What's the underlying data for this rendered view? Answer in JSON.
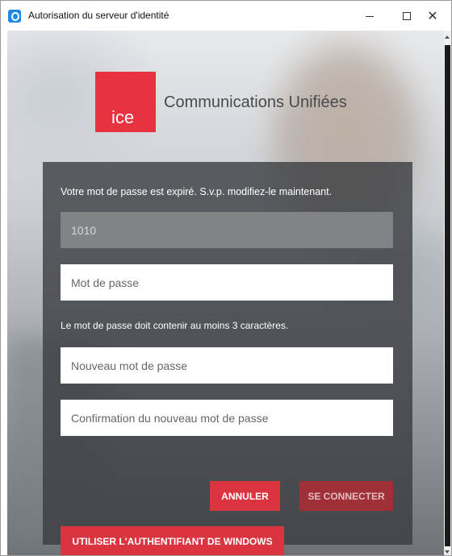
{
  "window": {
    "title": "Autorisation du serveur d'identité",
    "close_label": "✕"
  },
  "brand": {
    "logo_text": "ice",
    "name": "Communications Unifiées"
  },
  "form": {
    "expired_message": "Votre mot de passe est expiré. S.v.p. modifiez-le maintenant.",
    "username_value": "1010",
    "password_placeholder": "Mot de passe",
    "rule_message": "Le mot de passe doit contenir au moins 3 caractères.",
    "new_password_placeholder": "Nouveau mot de passe",
    "confirm_password_placeholder": "Confirmation du nouveau mot de passe"
  },
  "buttons": {
    "cancel": "ANNULER",
    "connect": "SE CONNECTER",
    "windows_auth": "UTILISER L'AUTHENTIFIANT DE WINDOWS"
  },
  "colors": {
    "accent": "#d9343f",
    "logo": "#e8323f",
    "app_icon": "#1e88e5"
  }
}
